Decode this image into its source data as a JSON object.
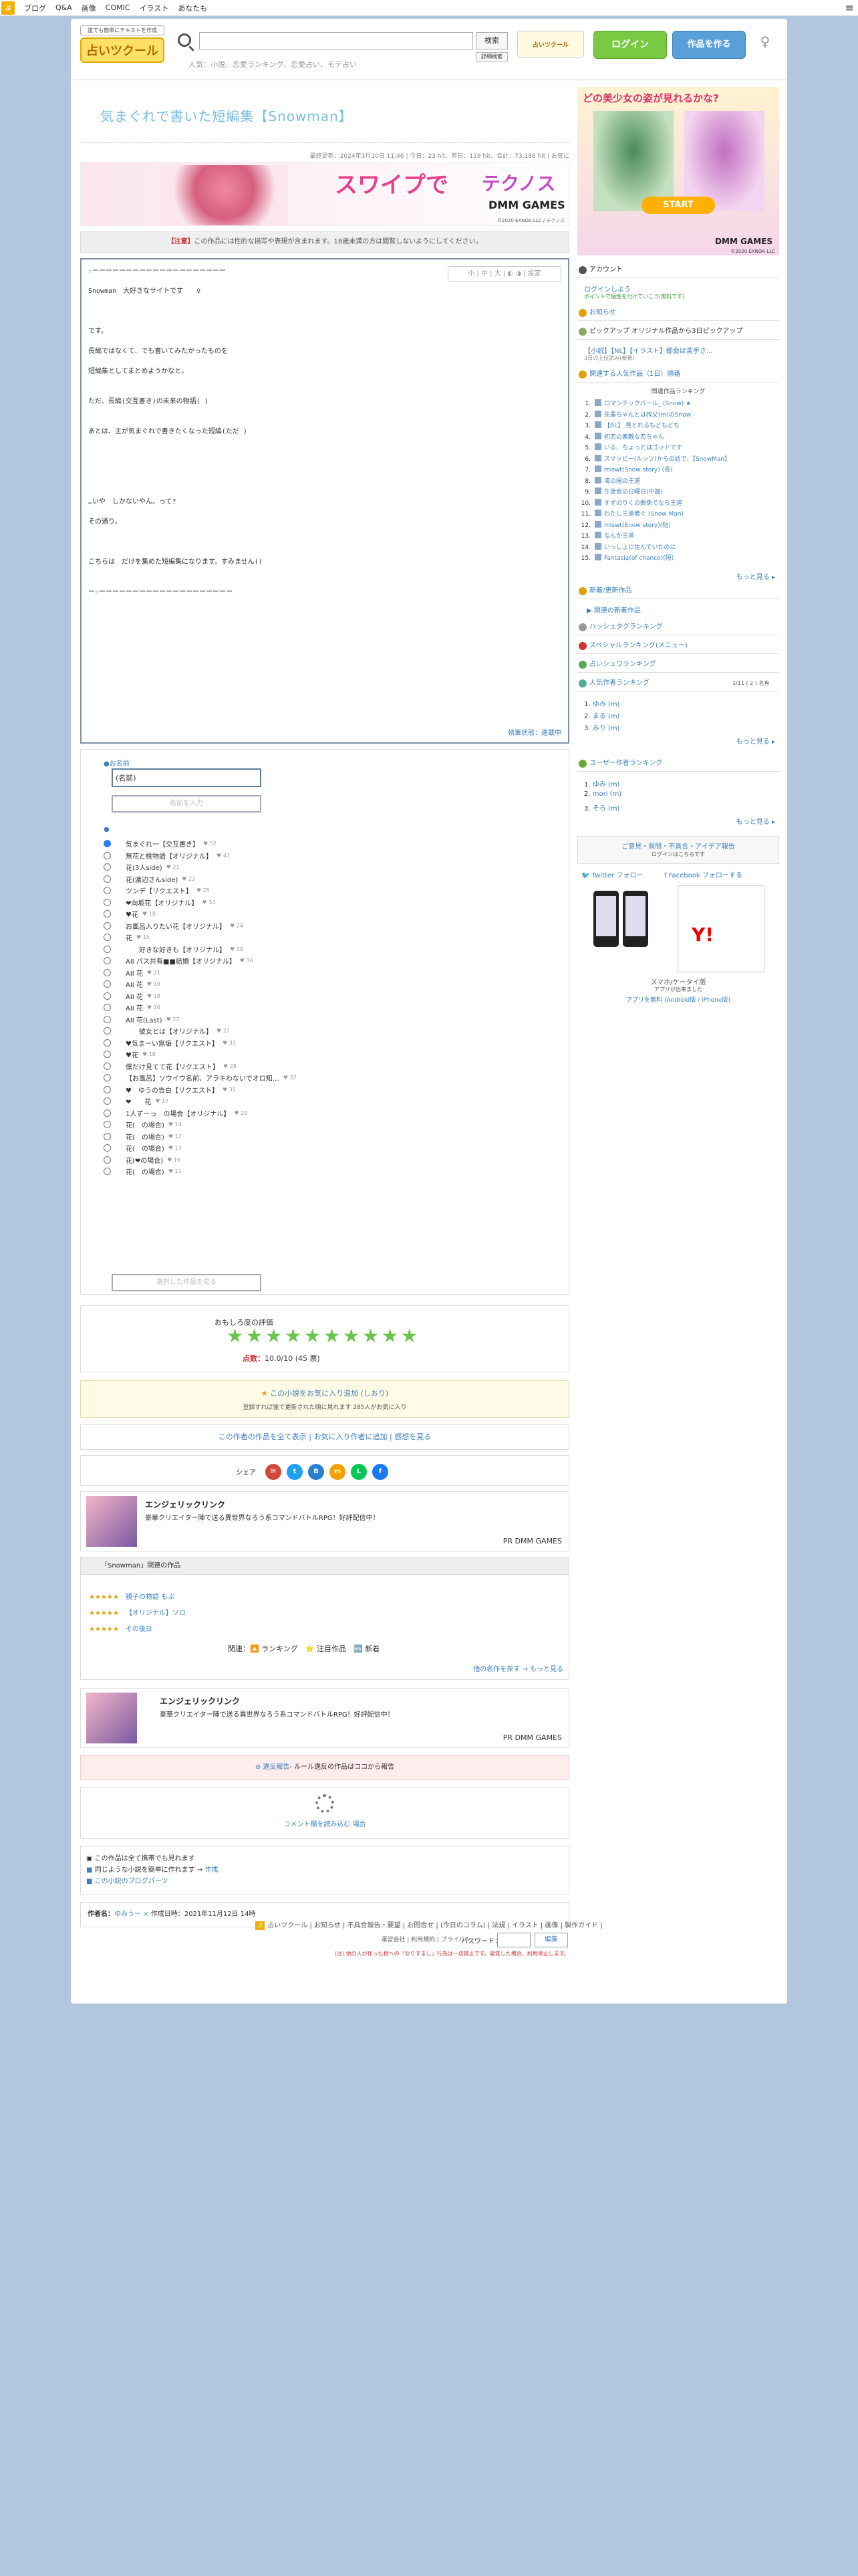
{
  "topbar": {
    "logo": "ぷ",
    "links": [
      "ブログ",
      "Q&A",
      "画像",
      "COMIC",
      "イラスト",
      "あなたも"
    ]
  },
  "header": {
    "logo_small": "誰でも簡単にテキストを作成",
    "logo_main": "占いツクール",
    "search_placeholder": "",
    "search_button": "検索",
    "search_detail": "詳細検索",
    "search_hint": "人気：小説、恋愛ランキング、恋愛占い、モテ占い",
    "mini_banner": "占いツクール",
    "login": "ログイン",
    "create": "作品を作る"
  },
  "work": {
    "title": "気まぐれで書いた短編集【Snowman】",
    "meta": "最終更新：2024年3月10日 11:46 | 今日：23 hit、昨日：119 hit、合計：73,186 hit | お気に",
    "notice_prefix": "【注意】",
    "notice": "この作品には性的な描写や表現が含まれます。18歳未満の方は閲覧しないようにしてください。",
    "tools": "小 | 中 | 大 | ◐ ◑ | 設定",
    "body": "☆ーーーーーーーーーーーーーーーーーーーー\n\nSnowman　大好きなサイトです　　♀\n\n\n\nです。\n\n長編ではなくて、でも書いてみたかったものを\n\n短編集としてまとめようかなと。\n\n\nただ、長編(交互書き)の未来の物語( )\n\n\nあとは、主が気まぐれで書きたくなった短編(ただ )\n\n\n\n\n\n\n…いや　しかないやん。って?\n\nその通り。\n\n\n\nこちらは　だけを集めた短編集になります。すみません((\n\n\nー☆ーーーーーーーーーーーーーーーーーーーー",
    "body_footer": "執筆状態：連載中"
  },
  "banner": {
    "title": "スワイプで",
    "title2": "テクノス",
    "dmm": "DMM GAMES",
    "copy": "©2020 EXNOA LLC / テクノス"
  },
  "form": {
    "name_label": "お名前",
    "name_value": "(名前)",
    "name_button": "名前を入力",
    "choices_label": "",
    "options": [
      {
        "label": "気まぐれ一【交互書き】",
        "cnt": "♥ 52"
      },
      {
        "label": "無花と桃物語【オリジナル】",
        "cnt": "♥ 41"
      },
      {
        "label": "花(3人side)",
        "cnt": "♥ 21"
      },
      {
        "label": "花(渡辺さんside)",
        "cnt": "♥ 22"
      },
      {
        "label": "ツンデ【リクエスト】",
        "cnt": "♥ 25"
      },
      {
        "label": "❤向坂花【オリジナル】",
        "cnt": "♥ 34"
      },
      {
        "label": "♥花",
        "cnt": "♥ 18"
      },
      {
        "label": "お風呂入りたい花【オリジナル】",
        "cnt": "♥ 24"
      },
      {
        "label": "花",
        "cnt": "♥ 15"
      },
      {
        "label": "　　好きな好きも【オリジナル】",
        "cnt": "♥ 30"
      },
      {
        "label": "AII パス共有■■結婚【オリジナル】",
        "cnt": "♥ 36"
      },
      {
        "label": "AII 花",
        "cnt": "♥ 21"
      },
      {
        "label": "AII 花",
        "cnt": "♥ 19"
      },
      {
        "label": "AII 花",
        "cnt": "♥ 18"
      },
      {
        "label": "AII 花",
        "cnt": "♥ 16"
      },
      {
        "label": "AII 花(Last)",
        "cnt": "♥ 27"
      },
      {
        "label": "　　彼女とは【オリジナル】",
        "cnt": "♥ 27"
      },
      {
        "label": "♥気まーい無垢【リクエスト】",
        "cnt": "♥ 33"
      },
      {
        "label": "♥花",
        "cnt": "♥ 18"
      },
      {
        "label": "僕だけ見てて花【リクエスト】",
        "cnt": "♥ 28"
      },
      {
        "label": "【お風呂】ソウイウ名前、アラキわないでオロ知…",
        "cnt": "♥ 37"
      },
      {
        "label": "♥　ゆうの告白【リクエスト】",
        "cnt": "♥ 35"
      },
      {
        "label": "❤　　花",
        "cnt": "♥ 17"
      },
      {
        "label": "1人ずーっ　の場合【オリジナル】",
        "cnt": "♥ 29"
      },
      {
        "label": "花(　の場合)",
        "cnt": "♥ 14"
      },
      {
        "label": "花(　の場合)",
        "cnt": "♥ 12"
      },
      {
        "label": "花(　の場合)",
        "cnt": "♥ 13"
      },
      {
        "label": "花(❤の場合)",
        "cnt": "♥ 16"
      },
      {
        "label": "花(　の場合)",
        "cnt": "♥ 11"
      }
    ],
    "vote_button": "選択した作品を見る"
  },
  "rating": {
    "title": "おもしろ度の評価",
    "value_label": "点数：",
    "value": "10.0/10 (45 票)",
    "stars": 10
  },
  "fav": {
    "line1": "この小説をお気に入り追加 (しおり)",
    "line2": "登録すれば後で更新された順に見れます 285人がお気に入り"
  },
  "actions": {
    "text": "この作者の作品を全て表示 | お気に入り作者に追加 | 感想を見る"
  },
  "share": {
    "label": "シェア"
  },
  "ad": {
    "title": "エンジェリックリンク",
    "sub": "豪華クリエイター陣で送る異世界なろう系コマンドバトルRPG！好評配信中！",
    "pr": "PR DMM GAMES"
  },
  "related": {
    "head": "「Snowman」関連の作品",
    "items": [
      "親子の物語 もぶ",
      "【オリジナル】ソロ",
      "その後日"
    ],
    "nav": "関連：🔼 ランキング　⭐ 注目作品　🆕 新着",
    "more": "他の名作を探す → もっと見る"
  },
  "report": {
    "icon": "⊖",
    "text": "違反報告",
    "rest": "- ルール違反の作品はココから報告"
  },
  "comment": {
    "text": "コメント欄を読み込む 場合"
  },
  "qr": {
    "l1": "この作品は全て携帯でも見れます",
    "l2": "同じような小説を簡単に作れます → ",
    "l2_link": "作成",
    "l3": "この小説のブログパーツ"
  },
  "author": {
    "label": "作者名：",
    "name": "ゆみうー ×  ",
    "date": "作成日時：2021年11月12日 14時"
  },
  "pw": {
    "label": "パスワード：",
    "button": "編集",
    "note": "(注) 他の人が作った物への「なりすまし」行為は一切禁止です。発覚した場合、利用停止します。"
  },
  "footer": {
    "l1": "占いツクール | お知らせ | 不具合報告・要望 | お問合せ | (今日のコラム) | 法規 | イラスト | 画像 | 製作ガイド |",
    "l2": "運営会社 | 利用規約 | プライバシー"
  },
  "side": {
    "ad_title": "どの美少女の姿が見れるかな?",
    "ad_start": "START",
    "ad_dmm": "DMM GAMES",
    "ad_copy": "©2020 EXNOA LLC",
    "account": "アカウント",
    "login_link": "ログインしよう",
    "login_sub": "ポイントで個性を付けていこう(無料です)",
    "news": "お知らせ",
    "pickup": "ピックアップ オリジナル作品から3日ピックアップ",
    "pickup_link": "【小説】【NL】【イラスト】都会は苦手さ...",
    "pickup_sub": "3日の上位読み(新着)",
    "rank_head": "関連する人気作品（1日）順番",
    "rank_sub": "関連作品ランキング",
    "ranks": [
      "ロマンチックパール_ (Snow) ★",
      "先輩ちゃんとは叔父(m)のSnow",
      "【BL】 見とれるもどもどち",
      "初恋の素敵な恋ちゃん",
      "いる、ちょっとはゴッドです",
      "スマッピー(ルッツ)からの話で、【SnowMan】",
      "miswt(Snow story) (長)",
      "海の国の王道",
      "生徒会の日曜日(中篇)",
      "すずのりくの関係でなら王道",
      "わたし王道者ぐ (Snow Man)",
      "miswt(Snow story)(短)",
      "なんか王道",
      "いっしょに住んでいたのに",
      "Fantasia(of chance)(短)"
    ],
    "more": "もっと見る ▸",
    "new_head": "新着/更新作品",
    "new_link": "▶ 関連の新着作品",
    "hashtag": "ハッシュタグランキング",
    "sp_rank": "スペシャルランキング(メニュー)",
    "rec": "占いシュワランキング",
    "popular_head": "人気作者ランキング",
    "popular_sub": "1/11 ( 2 ) 名有",
    "pop": [
      "ゆみ (m)",
      "まる (m)",
      "みり (m)"
    ],
    "user_head": "ユーザー作者ランキング",
    "users": [
      "ゆみ (m)",
      "mori (m)",
      "そら (m)"
    ],
    "info_title": "ご意見・質問・不具合・アイデア報告",
    "info_sub": "ログインはこちらです",
    "twitter": "Twitter フォロー",
    "facebook": "Facebook フォローする",
    "app_t": "スマホ/ケータイ版",
    "app_s": "アプリが出来ました",
    "app_l": "アプリを無料 (Android版 / iPhone版)"
  }
}
